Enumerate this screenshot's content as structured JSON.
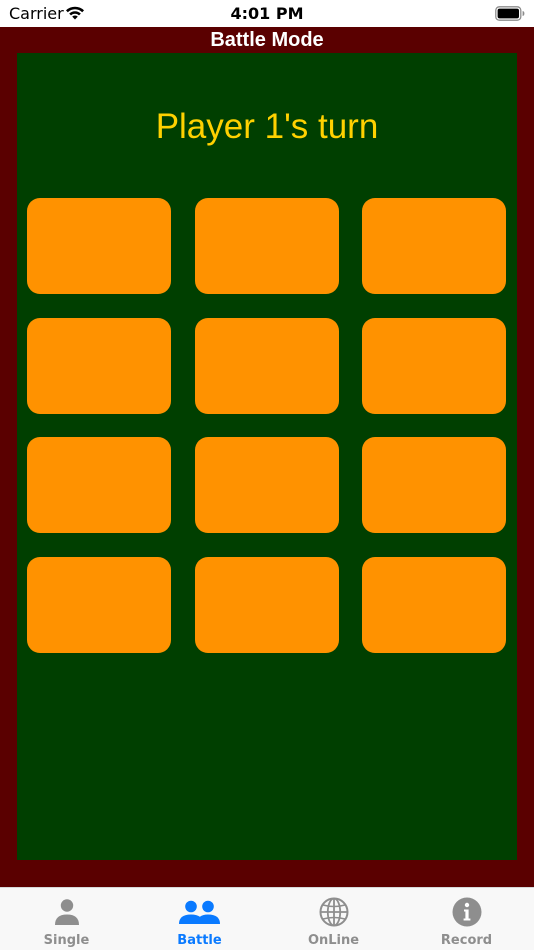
{
  "status_bar": {
    "carrier": "Carrier",
    "time": "4:01 PM"
  },
  "app": {
    "title": "Battle Mode",
    "turn_text": "Player 1's turn"
  },
  "colors": {
    "frame": "#5a0000",
    "board": "#003f00",
    "card": "#ff9200",
    "turn_text": "#ffd100",
    "tab_active": "#0a7aff",
    "tab_inactive": "#8e8e8e"
  },
  "cards": {
    "rows": 4,
    "columns": 3,
    "count": 12
  },
  "tabs": [
    {
      "label": "Single",
      "icon": "person-icon",
      "active": false
    },
    {
      "label": "Battle",
      "icon": "two-people-icon",
      "active": true
    },
    {
      "label": "OnLine",
      "icon": "globe-icon",
      "active": false
    },
    {
      "label": "Record",
      "icon": "info-icon",
      "active": false
    }
  ]
}
